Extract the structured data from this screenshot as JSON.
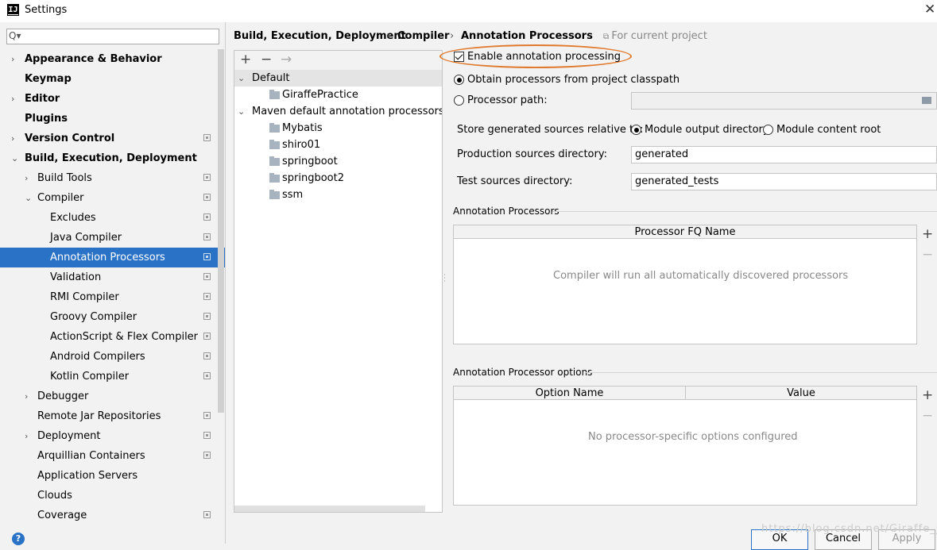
{
  "window": {
    "title": "Settings",
    "app_icon": "IJ",
    "close_glyph": "✕"
  },
  "search": {
    "placeholder": "",
    "icon_glyph": "Q▾"
  },
  "sidebar": {
    "items": [
      {
        "label": "Appearance & Behavior",
        "bold": true,
        "arrow": "›",
        "level": 0
      },
      {
        "label": "Keymap",
        "bold": true,
        "arrow": "",
        "level": 0
      },
      {
        "label": "Editor",
        "bold": true,
        "arrow": "›",
        "level": 0
      },
      {
        "label": "Plugins",
        "bold": true,
        "arrow": "",
        "level": 0
      },
      {
        "label": "Version Control",
        "bold": true,
        "arrow": "›",
        "level": 0,
        "project": true
      },
      {
        "label": "Build, Execution, Deployment",
        "bold": true,
        "arrow": "⌄",
        "level": 0
      },
      {
        "label": "Build Tools",
        "arrow": "›",
        "level": 1,
        "project": true
      },
      {
        "label": "Compiler",
        "arrow": "⌄",
        "level": 1,
        "project": true
      },
      {
        "label": "Excludes",
        "arrow": "",
        "level": 2,
        "project": true
      },
      {
        "label": "Java Compiler",
        "arrow": "",
        "level": 2,
        "project": true
      },
      {
        "label": "Annotation Processors",
        "arrow": "",
        "level": 2,
        "project": true,
        "selected": true
      },
      {
        "label": "Validation",
        "arrow": "",
        "level": 2,
        "project": true
      },
      {
        "label": "RMI Compiler",
        "arrow": "",
        "level": 2,
        "project": true
      },
      {
        "label": "Groovy Compiler",
        "arrow": "",
        "level": 2,
        "project": true
      },
      {
        "label": "ActionScript & Flex Compiler",
        "arrow": "",
        "level": 2,
        "project": true
      },
      {
        "label": "Android Compilers",
        "arrow": "",
        "level": 2,
        "project": true
      },
      {
        "label": "Kotlin Compiler",
        "arrow": "",
        "level": 2,
        "project": true
      },
      {
        "label": "Debugger",
        "arrow": "›",
        "level": 1
      },
      {
        "label": "Remote Jar Repositories",
        "arrow": "",
        "level": 1,
        "project": true
      },
      {
        "label": "Deployment",
        "arrow": "›",
        "level": 1,
        "project": true
      },
      {
        "label": "Arquillian Containers",
        "arrow": "",
        "level": 1,
        "project": true
      },
      {
        "label": "Application Servers",
        "arrow": "",
        "level": 1
      },
      {
        "label": "Clouds",
        "arrow": "",
        "level": 1
      },
      {
        "label": "Coverage",
        "arrow": "",
        "level": 1,
        "project": true
      }
    ]
  },
  "breadcrumb": {
    "items": [
      "Build, Execution, Deployment",
      "Compiler",
      "Annotation Processors"
    ],
    "separator": "›",
    "scope": "For current project"
  },
  "profiles": {
    "toolbar": {
      "add": "+",
      "remove": "−",
      "move": "→"
    },
    "items": [
      {
        "label": "Default",
        "arrow": "⌄",
        "indent": 0,
        "selected": true
      },
      {
        "label": "GiraffePractice",
        "folder": true,
        "indent": 1
      },
      {
        "label": "Maven default annotation processors profile",
        "arrow": "⌄",
        "indent": 0
      },
      {
        "label": "Mybatis",
        "folder": true,
        "indent": 1
      },
      {
        "label": "shiro01",
        "folder": true,
        "indent": 1
      },
      {
        "label": "springboot",
        "folder": true,
        "indent": 1
      },
      {
        "label": "springboot2",
        "folder": true,
        "indent": 1
      },
      {
        "label": "ssm",
        "folder": true,
        "indent": 1
      }
    ]
  },
  "settings": {
    "enable_processing": {
      "label": "Enable annotation processing",
      "checked": true
    },
    "obtain_classpath": {
      "label": "Obtain processors from project classpath",
      "checked": true
    },
    "processor_path": {
      "label": "Processor path:",
      "checked": false,
      "value": ""
    },
    "store_relative": {
      "label": "Store generated sources relative to:",
      "option1": "Module output directory",
      "option2": "Module content root",
      "selected": "Module output directory"
    },
    "production_dir": {
      "label": "Production sources directory:",
      "value": "generated"
    },
    "test_dir": {
      "label": "Test sources directory:",
      "value": "generated_tests"
    }
  },
  "processors_section": {
    "title": "Annotation Processors",
    "column": "Processor FQ Name",
    "empty": "Compiler will run all automatically discovered processors",
    "add": "+",
    "remove": "−"
  },
  "options_section": {
    "title": "Annotation Processor options",
    "columns": [
      "Option Name",
      "Value"
    ],
    "empty": "No processor-specific options configured",
    "add": "+",
    "remove": "−"
  },
  "buttons": {
    "ok": "OK",
    "cancel": "Cancel",
    "apply": "Apply",
    "help": "?"
  },
  "watermark": "https://blog.csdn.net/Giraffe_ji",
  "colors": {
    "selection": "#2a72c6",
    "highlight_oval": "#e07a2e"
  }
}
